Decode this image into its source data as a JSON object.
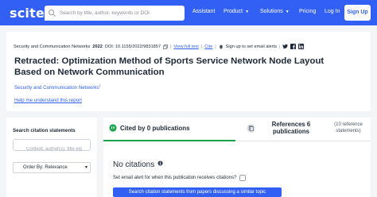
{
  "brand": {
    "logo_text": "scite_",
    "primary_color": "#3260f5",
    "success_color": "#16a34a"
  },
  "search": {
    "placeholder": "Search by title, author, keywords or DOI"
  },
  "nav": {
    "assistant": "Assistant",
    "product": "Product",
    "solutions": "Solutions",
    "pricing": "Pricing",
    "login": "Log In",
    "signup": "Sign Up"
  },
  "paper": {
    "journal": "Security and Communication Networks",
    "year": "2022",
    "doi": "DOI: 10.1155/2022/9831857",
    "view_full_text": "View full text",
    "cite": "Cite",
    "signup_alerts": "Sign up to set email alerts",
    "title": "Retracted: Optimization Method of Sports Service Network Node Layout Based on Network Communication",
    "author_link": "Security and Communication Networks",
    "author_sup": "1",
    "help_link": "Help me understand this report"
  },
  "filters": {
    "title": "Search citation statements",
    "context_placeholder": "Context, author(s), title etc",
    "order_label": "Order By: Relevance"
  },
  "tabs": {
    "cited_by": "Cited by 0 publications",
    "references": "References 6 publications",
    "references_sub": "(10 reference statements)"
  },
  "results": {
    "no_citations": "No citations",
    "alert_prompt": "Set email alert for when this publication receives citations?",
    "search_button": "Search citation statements from papers discussing a similar topic"
  },
  "icons": [
    "search-icon",
    "chevron-down-icon",
    "copy-icon",
    "bell-icon",
    "twitter-icon",
    "facebook-icon",
    "linkedin-icon",
    "cited-by-icon",
    "references-icon",
    "info-icon",
    "sort-icon"
  ]
}
